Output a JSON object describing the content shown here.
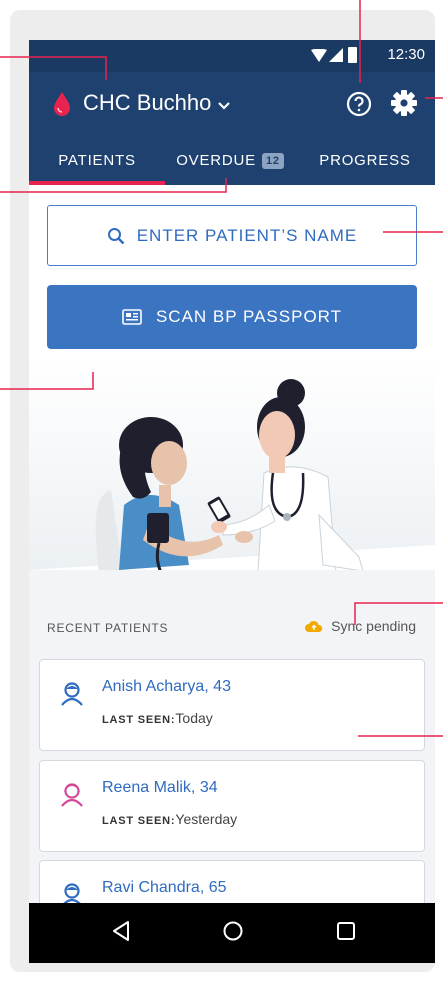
{
  "status_bar": {
    "time": "12:30"
  },
  "header": {
    "facility_name": "CHC Buchho",
    "icons": [
      "blood-drop-icon",
      "chevron-down-icon",
      "help-icon",
      "settings-gear-icon"
    ]
  },
  "tabs": [
    {
      "label": "PATIENTS",
      "active": true
    },
    {
      "label": "OVERDUE",
      "badge": "12",
      "active": false
    },
    {
      "label": "PROGRESS",
      "active": false
    }
  ],
  "search": {
    "label": "ENTER PATIENT’S NAME"
  },
  "scan": {
    "label": "SCAN BP PASSPORT"
  },
  "recent": {
    "title": "RECENT PATIENTS",
    "sync_status": "Sync pending",
    "last_seen_label": "LAST SEEN:",
    "patients": [
      {
        "name": "Anish Acharya, 43",
        "last_seen": "Today",
        "avatar_color": "#2f6bbf"
      },
      {
        "name": "Reena Malik, 34",
        "last_seen": "Yesterday",
        "avatar_color": "#d44a9a"
      },
      {
        "name": "Ravi Chandra, 65",
        "last_seen": "",
        "avatar_color": "#2f6bbf"
      }
    ]
  },
  "colors": {
    "app_bar": "#1e416f",
    "status_bar": "#1a3a63",
    "accent": "#e8234e",
    "primary": "#3b74c0",
    "link": "#2f6bbf",
    "sync_icon": "#f2a900"
  }
}
